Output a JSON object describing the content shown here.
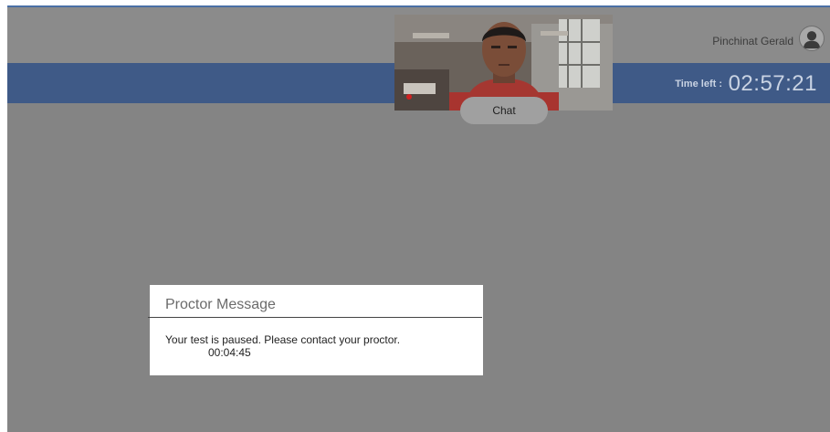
{
  "header": {
    "user_name": "Pinchinat Gerald",
    "time_left_label": "Time left :",
    "time_left_value": "02:57:21"
  },
  "webcam": {
    "chat_label": "Chat"
  },
  "modal": {
    "title": "Proctor Message",
    "message": "Your test is paused. Please contact your proctor.",
    "countdown": "00:04:45"
  },
  "icons": {
    "avatar": "user-avatar-icon"
  },
  "colors": {
    "header_blue": "#3f5a87",
    "overlay_gray": "#848484",
    "modal_bg": "#ffffff"
  }
}
